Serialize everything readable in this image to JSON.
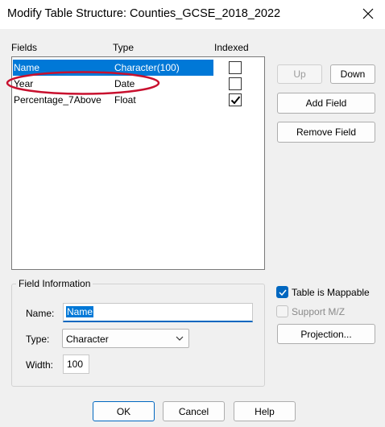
{
  "window": {
    "title": "Modify Table Structure: Counties_GCSE_2018_2022",
    "close_icon": "close-icon"
  },
  "fields_list": {
    "headers": {
      "fields": "Fields",
      "type": "Type",
      "indexed": "Indexed"
    },
    "rows": [
      {
        "name": "Name",
        "type": "Character(100)",
        "indexed": false,
        "selected": true
      },
      {
        "name": "Year",
        "type": "Date",
        "indexed": false,
        "selected": false
      },
      {
        "name": "Percentage_7Above",
        "type": "Float",
        "indexed": true,
        "selected": false
      }
    ]
  },
  "side_buttons": {
    "up": "Up",
    "down": "Down",
    "add_field": "Add Field",
    "remove_field": "Remove Field"
  },
  "field_information": {
    "group_title": "Field Information",
    "name_label": "Name:",
    "name_value": "Name",
    "type_label": "Type:",
    "type_value": "Character",
    "width_label": "Width:",
    "width_value": "100"
  },
  "options": {
    "table_mappable_label": "Table is Mappable",
    "table_mappable_checked": true,
    "support_mz_label": "Support M/Z",
    "support_mz_checked": false,
    "projection_label": "Projection..."
  },
  "footer": {
    "ok": "OK",
    "cancel": "Cancel",
    "help": "Help"
  },
  "colors": {
    "selection": "#0078d7",
    "annotation": "#c8102e",
    "accent": "#0067c0"
  }
}
